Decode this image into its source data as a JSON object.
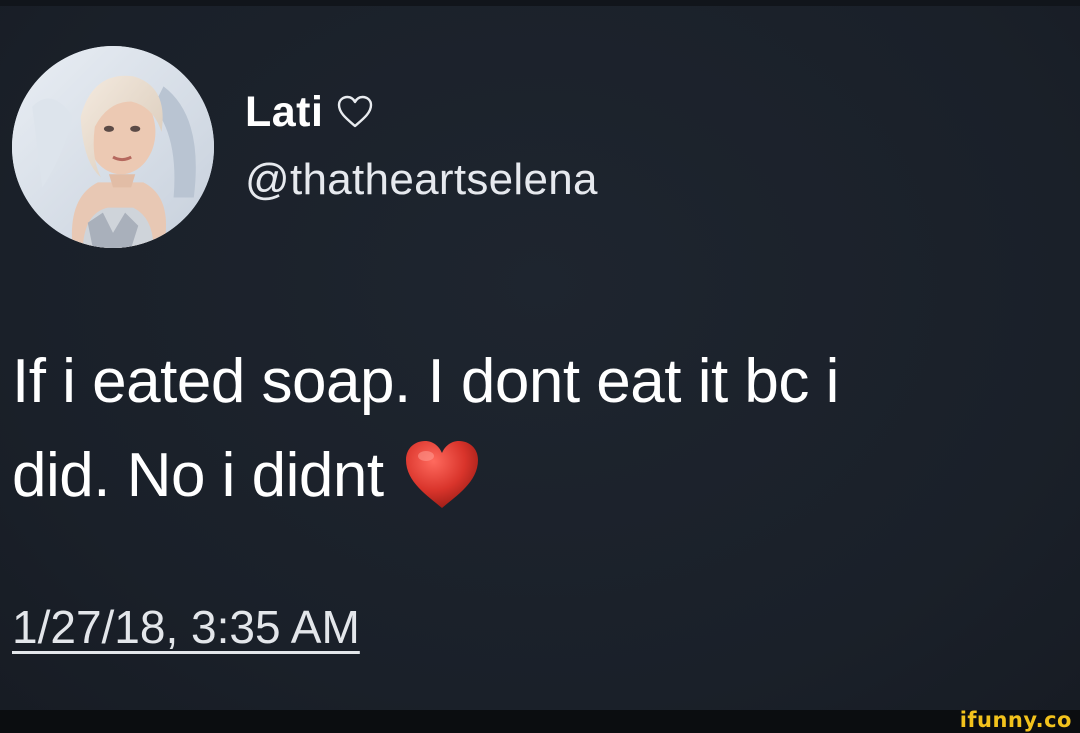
{
  "tweet": {
    "display_name": "Lati",
    "name_icon": "heart-outline-icon",
    "handle": "@thatheartselena",
    "text_line1": "If i eated soap. I dont eat it bc i",
    "text_line2": "did. No i didnt",
    "text_emoji": "red-heart-icon",
    "timestamp": "1/27/18, 3:35 AM"
  },
  "watermark": {
    "text": "ifunny.co"
  },
  "colors": {
    "background": "#1c222b",
    "text": "#ffffff",
    "heart": "#d9342b",
    "watermark": "#f2c21c"
  }
}
